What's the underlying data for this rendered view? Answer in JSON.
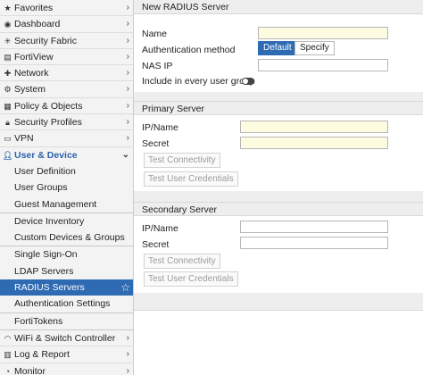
{
  "sidebar": {
    "items": [
      {
        "label": "Favorites",
        "icon": "star-icon"
      },
      {
        "label": "Dashboard",
        "icon": "dashboard-icon"
      },
      {
        "label": "Security Fabric",
        "icon": "fabric-icon"
      },
      {
        "label": "FortiView",
        "icon": "chart-icon"
      },
      {
        "label": "Network",
        "icon": "network-icon"
      },
      {
        "label": "System",
        "icon": "gear-icon"
      },
      {
        "label": "Policy & Objects",
        "icon": "policy-icon"
      },
      {
        "label": "Security Profiles",
        "icon": "lock-icon"
      },
      {
        "label": "VPN",
        "icon": "monitor-icon"
      }
    ],
    "section": {
      "label": "User & Device",
      "icon": "user-icon"
    },
    "group1": [
      "User Definition",
      "User Groups",
      "Guest Management"
    ],
    "group2": [
      "Device Inventory",
      "Custom Devices & Groups"
    ],
    "group3": [
      "Single Sign-On",
      "LDAP Servers",
      "RADIUS Servers",
      "Authentication Settings"
    ],
    "group4": [
      "FortiTokens"
    ],
    "bottom": [
      {
        "label": "WiFi & Switch Controller",
        "icon": "wifi-icon"
      },
      {
        "label": "Log & Report",
        "icon": "chart-icon"
      },
      {
        "label": "Monitor",
        "icon": "monitor-icon"
      }
    ]
  },
  "form": {
    "title": "New RADIUS Server",
    "name_label": "Name",
    "auth_label": "Authentication method",
    "auth_default": "Default",
    "auth_specify": "Specify",
    "nas_label": "NAS IP",
    "include_label": "Include in every user group",
    "primary": {
      "header": "Primary Server",
      "ip_label": "IP/Name",
      "secret_label": "Secret",
      "test_conn": "Test Connectivity",
      "test_cred": "Test User Credentials"
    },
    "secondary": {
      "header": "Secondary Server",
      "ip_label": "IP/Name",
      "secret_label": "Secret",
      "test_conn": "Test Connectivity",
      "test_cred": "Test User Credentials"
    }
  },
  "colors": {
    "accent": "#2f6bb3",
    "field_yellow": "#fdfbe0"
  }
}
